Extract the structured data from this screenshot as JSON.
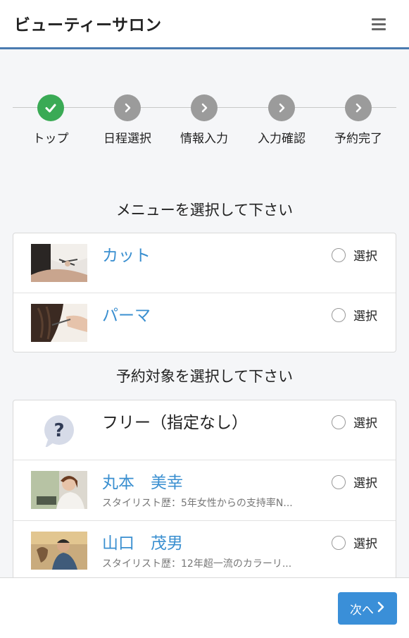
{
  "header": {
    "title": "ビューティーサロン",
    "menu_icon": "hamburger-icon"
  },
  "steps": [
    {
      "label": "トップ",
      "state": "done"
    },
    {
      "label": "日程選択",
      "state": "pending"
    },
    {
      "label": "情報入力",
      "state": "pending"
    },
    {
      "label": "入力確認",
      "state": "pending"
    },
    {
      "label": "予約完了",
      "state": "pending"
    }
  ],
  "menu_section": {
    "title": "メニューを選択して下さい",
    "items": [
      {
        "name": "カット",
        "select_label": "選択"
      },
      {
        "name": "パーマ",
        "select_label": "選択"
      }
    ]
  },
  "target_section": {
    "title": "予約対象を選択して下さい",
    "items": [
      {
        "name": "フリー（指定なし）",
        "subtitle": "",
        "select_label": "選択"
      },
      {
        "name": "丸本　美幸",
        "subtitle": "スタイリスト歴：5年女性からの支持率N...",
        "select_label": "選択"
      },
      {
        "name": "山口　茂男",
        "subtitle": "スタイリスト歴：12年超一流のカラーリ...",
        "select_label": "選択"
      }
    ]
  },
  "footer": {
    "next_label": "次へ"
  },
  "colors": {
    "accent": "#3a8fd8",
    "header_border": "#4a7bb0",
    "step_done": "#3aaa55",
    "step_pending": "#9b9b9b",
    "link_text": "#3a8fd0"
  }
}
